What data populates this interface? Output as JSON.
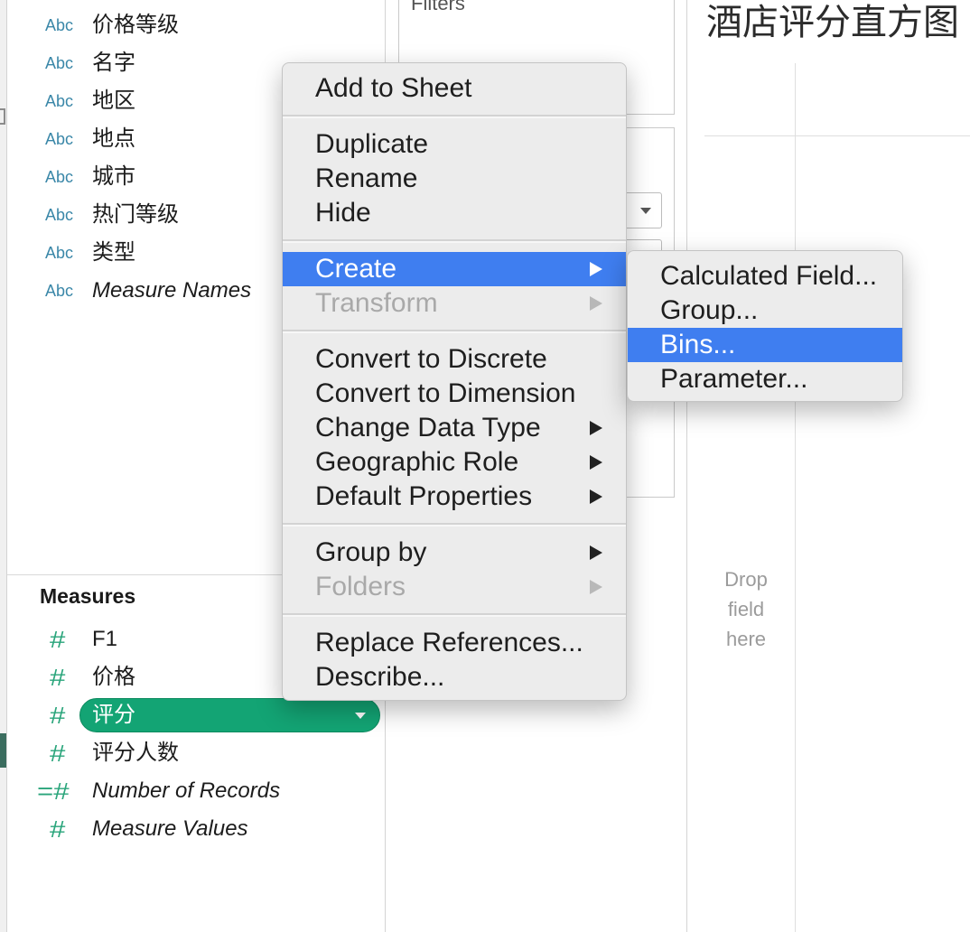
{
  "colors": {
    "dimension_icon": "#3a87a8",
    "measure_icon": "#2aa57b",
    "selected_pill": "#13a474",
    "menu_highlight": "#3f7ef0",
    "menu_background": "#ececec",
    "disabled_text": "#a9a9a9"
  },
  "icons": {
    "submenu_arrow": "triangle-right-icon",
    "pill_dropdown": "triangle-down-icon",
    "shelf_dropdown": "triangle-down-icon"
  },
  "data_pane": {
    "dimensions": [
      {
        "icon": "Abc",
        "label": "价格等级"
      },
      {
        "icon": "Abc",
        "label": "名字"
      },
      {
        "icon": "Abc",
        "label": "地区"
      },
      {
        "icon": "Abc",
        "label": "地点"
      },
      {
        "icon": "Abc",
        "label": "城市"
      },
      {
        "icon": "Abc",
        "label": "热门等级"
      },
      {
        "icon": "Abc",
        "label": "类型"
      },
      {
        "icon": "Abc",
        "label": "Measure Names"
      }
    ],
    "measures_header": "Measures",
    "measures": [
      {
        "icon": "#",
        "label": "F1"
      },
      {
        "icon": "#",
        "label": "价格"
      },
      {
        "icon": "#",
        "label": "评分",
        "selected": true
      },
      {
        "icon": "#",
        "label": "评分人数"
      },
      {
        "icon": "=#",
        "label": "Number of Records"
      },
      {
        "icon": "#",
        "label": "Measure Values"
      }
    ]
  },
  "shelves": {
    "filters_label": "Filters"
  },
  "view": {
    "title": "酒店评分直方图",
    "drop_hint": [
      "Drop",
      "field",
      "here"
    ]
  },
  "context_menu": {
    "groups": [
      [
        {
          "label": "Add to Sheet"
        }
      ],
      [
        {
          "label": "Duplicate"
        },
        {
          "label": "Rename"
        },
        {
          "label": "Hide"
        }
      ],
      [
        {
          "label": "Create",
          "has_submenu": true,
          "highlighted": true
        },
        {
          "label": "Transform",
          "has_submenu": true,
          "disabled": true
        }
      ],
      [
        {
          "label": "Convert to Discrete"
        },
        {
          "label": "Convert to Dimension"
        },
        {
          "label": "Change Data Type",
          "has_submenu": true
        },
        {
          "label": "Geographic Role",
          "has_submenu": true
        },
        {
          "label": "Default Properties",
          "has_submenu": true
        }
      ],
      [
        {
          "label": "Group by",
          "has_submenu": true
        },
        {
          "label": "Folders",
          "has_submenu": true,
          "disabled": true
        }
      ],
      [
        {
          "label": "Replace References..."
        },
        {
          "label": "Describe..."
        }
      ]
    ]
  },
  "create_submenu": {
    "items": [
      {
        "label": "Calculated Field..."
      },
      {
        "label": "Group..."
      },
      {
        "label": "Bins...",
        "highlighted": true
      },
      {
        "label": "Parameter..."
      }
    ]
  }
}
